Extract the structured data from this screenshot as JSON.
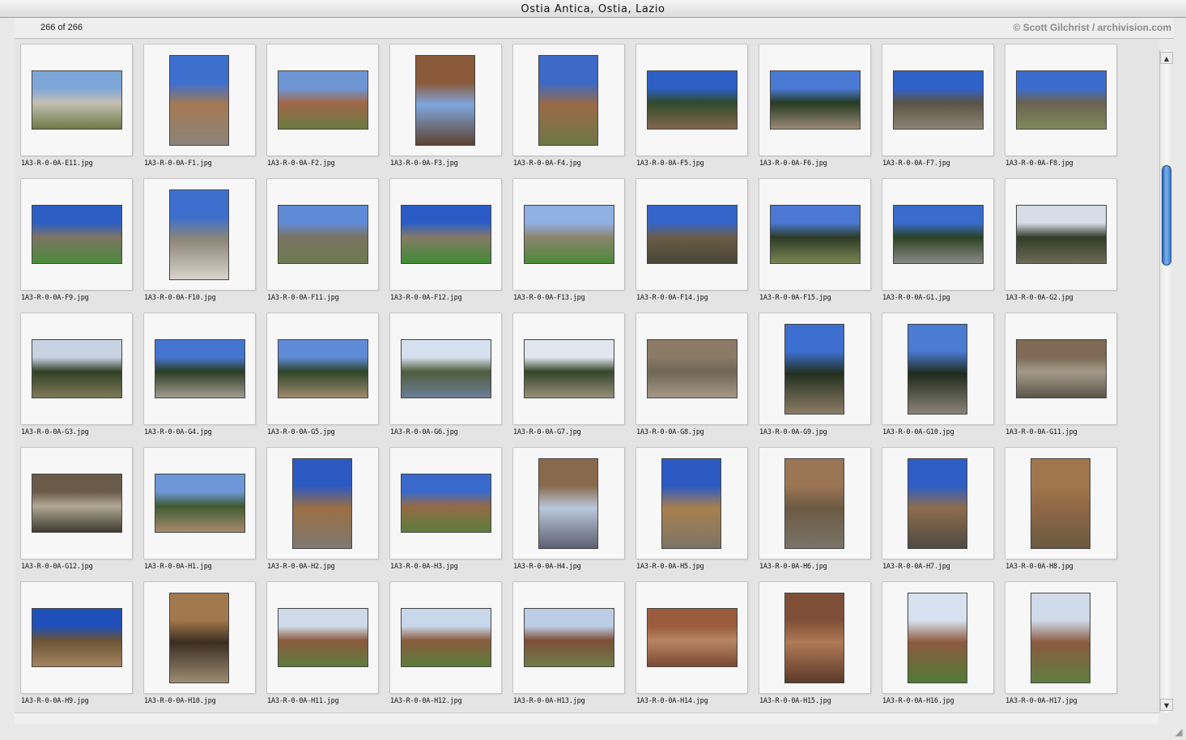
{
  "window": {
    "title": "Ostia Antica, Ostia, Lazio"
  },
  "info": {
    "count": "266 of 266",
    "credit": "© Scott Gilchrist / archivision.com"
  },
  "images": [
    {
      "name": "1A3-R-0-0A-E11.jpg",
      "orientation": "landscape",
      "colors": [
        "#7ea6d8",
        "#c4c0b4",
        "#6d7a45"
      ]
    },
    {
      "name": "1A3-R-0-0A-F1.jpg",
      "orientation": "portrait",
      "colors": [
        "#3d6fcf",
        "#a57a52",
        "#8b8378"
      ]
    },
    {
      "name": "1A3-R-0-0A-F2.jpg",
      "orientation": "landscape",
      "colors": [
        "#6f95d4",
        "#a0674a",
        "#6b7a40"
      ]
    },
    {
      "name": "1A3-R-0-0A-F3.jpg",
      "orientation": "portrait",
      "colors": [
        "#8a5a3a",
        "#7fa7dd",
        "#5d4232"
      ]
    },
    {
      "name": "1A3-R-0-0A-F4.jpg",
      "orientation": "portrait",
      "colors": [
        "#3c6ac6",
        "#9b6a45",
        "#6d7846"
      ]
    },
    {
      "name": "1A3-R-0-0A-F5.jpg",
      "orientation": "landscape",
      "colors": [
        "#2e5fc4",
        "#2f4a2a",
        "#836750"
      ]
    },
    {
      "name": "1A3-R-0-0A-F6.jpg",
      "orientation": "landscape",
      "colors": [
        "#4a7ad4",
        "#263a22",
        "#9a8a74"
      ]
    },
    {
      "name": "1A3-R-0-0A-F7.jpg",
      "orientation": "landscape",
      "colors": [
        "#2f62c8",
        "#5a5345",
        "#8d8474"
      ]
    },
    {
      "name": "1A3-R-0-0A-F8.jpg",
      "orientation": "landscape",
      "colors": [
        "#3b6ccd",
        "#6b6251",
        "#7f8a5a"
      ]
    },
    {
      "name": "1A3-R-0-0A-F9.jpg",
      "orientation": "landscape",
      "colors": [
        "#2c5ec4",
        "#7d7463",
        "#4a8a3a"
      ]
    },
    {
      "name": "1A3-R-0-0A-F10.jpg",
      "orientation": "portrait",
      "colors": [
        "#3d6fcf",
        "#8c8676",
        "#d8d4cc"
      ]
    },
    {
      "name": "1A3-R-0-0A-F11.jpg",
      "orientation": "landscape",
      "colors": [
        "#5f8ad6",
        "#7c7362",
        "#6a7a50"
      ]
    },
    {
      "name": "1A3-R-0-0A-F12.jpg",
      "orientation": "landscape",
      "colors": [
        "#2b5cc6",
        "#857a66",
        "#3f8b34"
      ]
    },
    {
      "name": "1A3-R-0-0A-F13.jpg",
      "orientation": "landscape",
      "colors": [
        "#8fb1e3",
        "#8d8470",
        "#4a8a36"
      ]
    },
    {
      "name": "1A3-R-0-0A-F14.jpg",
      "orientation": "landscape",
      "colors": [
        "#3565c9",
        "#6a5c48",
        "#4a4536"
      ]
    },
    {
      "name": "1A3-R-0-0A-F15.jpg",
      "orientation": "landscape",
      "colors": [
        "#4a78d2",
        "#2c3b25",
        "#7a8452"
      ]
    },
    {
      "name": "1A3-R-0-0A-G1.jpg",
      "orientation": "landscape",
      "colors": [
        "#3a6ccd",
        "#2b4225",
        "#8a8a84"
      ]
    },
    {
      "name": "1A3-R-0-0A-G2.jpg",
      "orientation": "landscape",
      "colors": [
        "#d6dde7",
        "#2f3c27",
        "#6c6a55"
      ]
    },
    {
      "name": "1A3-R-0-0A-G3.jpg",
      "orientation": "landscape",
      "colors": [
        "#c7d3e3",
        "#314026",
        "#7e7a58"
      ]
    },
    {
      "name": "1A3-R-0-0A-G4.jpg",
      "orientation": "landscape",
      "colors": [
        "#4575d1",
        "#2a3d24",
        "#a39d90"
      ]
    },
    {
      "name": "1A3-R-0-0A-G5.jpg",
      "orientation": "landscape",
      "colors": [
        "#5f8ad6",
        "#2d4528",
        "#a08a6c"
      ]
    },
    {
      "name": "1A3-R-0-0A-G6.jpg",
      "orientation": "landscape",
      "colors": [
        "#d5e0ee",
        "#4f5d3c",
        "#6c7c98"
      ]
    },
    {
      "name": "1A3-R-0-0A-G7.jpg",
      "orientation": "landscape",
      "colors": [
        "#e2e7ef",
        "#33452a",
        "#9a8e7a"
      ]
    },
    {
      "name": "1A3-R-0-0A-G8.jpg",
      "orientation": "landscape",
      "colors": [
        "#8b7a66",
        "#6f6657",
        "#a59986"
      ]
    },
    {
      "name": "1A3-R-0-0A-G9.jpg",
      "orientation": "portrait",
      "colors": [
        "#3d6fd0",
        "#23301f",
        "#8d7c66"
      ]
    },
    {
      "name": "1A3-R-0-0A-G10.jpg",
      "orientation": "portrait",
      "colors": [
        "#4b7bd2",
        "#1f2a1c",
        "#8c8378"
      ]
    },
    {
      "name": "1A3-R-0-0A-G11.jpg",
      "orientation": "landscape",
      "colors": [
        "#7e6a55",
        "#a49a8a",
        "#5d5648"
      ]
    },
    {
      "name": "1A3-R-0-0A-G12.jpg",
      "orientation": "landscape",
      "colors": [
        "#6a5b49",
        "#b0a893",
        "#3f3a31"
      ]
    },
    {
      "name": "1A3-R-0-0A-H1.jpg",
      "orientation": "landscape",
      "colors": [
        "#6e97d8",
        "#3e5a32",
        "#a88a6c"
      ]
    },
    {
      "name": "1A3-R-0-0A-H2.jpg",
      "orientation": "portrait",
      "colors": [
        "#2c5ac2",
        "#9b6e44",
        "#7f7a70"
      ]
    },
    {
      "name": "1A3-R-0-0A-H3.jpg",
      "orientation": "landscape",
      "colors": [
        "#3969cb",
        "#946a45",
        "#5d7d3e"
      ]
    },
    {
      "name": "1A3-R-0-0A-H4.jpg",
      "orientation": "portrait",
      "colors": [
        "#8a6a4c",
        "#b9c8dc",
        "#5e6072"
      ]
    },
    {
      "name": "1A3-R-0-0A-H5.jpg",
      "orientation": "portrait",
      "colors": [
        "#2c5ac2",
        "#a8804f",
        "#7c7466"
      ]
    },
    {
      "name": "1A3-R-0-0A-H6.jpg",
      "orientation": "portrait",
      "colors": [
        "#9a7654",
        "#6c5a44",
        "#7a7468"
      ]
    },
    {
      "name": "1A3-R-0-0A-H7.jpg",
      "orientation": "portrait",
      "colors": [
        "#2f5ec6",
        "#8d6c4b",
        "#4e4a44"
      ]
    },
    {
      "name": "1A3-R-0-0A-H8.jpg",
      "orientation": "portrait",
      "colors": [
        "#a1764e",
        "#8f6846",
        "#6b5a40"
      ]
    },
    {
      "name": "1A3-R-0-0A-H9.jpg",
      "orientation": "landscape",
      "colors": [
        "#1f4fb8",
        "#6b5335",
        "#a4845f"
      ]
    },
    {
      "name": "1A3-R-0-0A-H10.jpg",
      "orientation": "portrait",
      "colors": [
        "#a2784e",
        "#3b2d22",
        "#9c8c74"
      ]
    },
    {
      "name": "1A3-R-0-0A-H11.jpg",
      "orientation": "landscape",
      "colors": [
        "#d0dbe9",
        "#8c5a3e",
        "#5f7c3c"
      ]
    },
    {
      "name": "1A3-R-0-0A-H12.jpg",
      "orientation": "landscape",
      "colors": [
        "#c9d7ea",
        "#8a5b3e",
        "#5b7d3a"
      ]
    },
    {
      "name": "1A3-R-0-0A-H13.jpg",
      "orientation": "landscape",
      "colors": [
        "#bccde6",
        "#7e4e36",
        "#6e7f48"
      ]
    },
    {
      "name": "1A3-R-0-0A-H14.jpg",
      "orientation": "landscape",
      "colors": [
        "#9a5c3c",
        "#b88664",
        "#7a4a32"
      ]
    },
    {
      "name": "1A3-R-0-0A-H15.jpg",
      "orientation": "portrait",
      "colors": [
        "#7e4f36",
        "#b07a56",
        "#5c3a2a"
      ]
    },
    {
      "name": "1A3-R-0-0A-H16.jpg",
      "orientation": "portrait",
      "colors": [
        "#d8e1ef",
        "#8d5a3e",
        "#4f7a36"
      ]
    },
    {
      "name": "1A3-R-0-0A-H17.jpg",
      "orientation": "portrait",
      "colors": [
        "#cfdbe9",
        "#8a5a40",
        "#5f7e3f"
      ]
    }
  ],
  "scrollbar": {
    "position": 0.19
  },
  "icons": {
    "up_arrow": "up-arrow-icon",
    "down_arrow": "down-arrow-icon",
    "resize": "resize-grip-icon"
  }
}
